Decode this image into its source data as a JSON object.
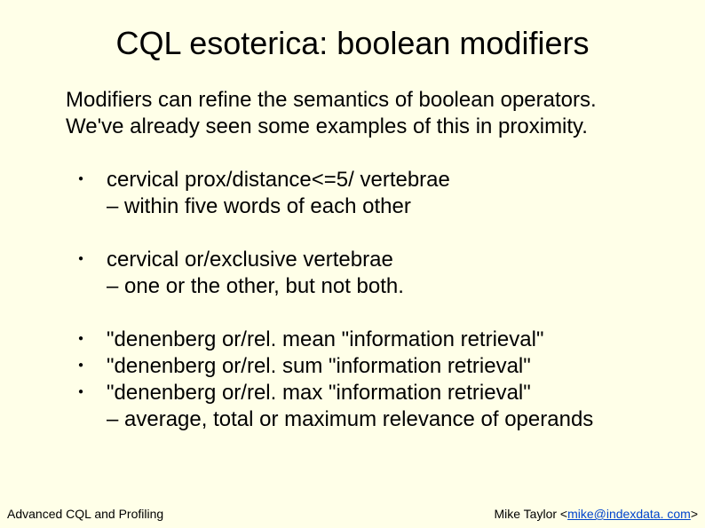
{
  "title": "CQL esoterica: boolean modifiers",
  "intro": "Modifiers can refine the semantics of boolean operators. We've already seen some examples of this in proximity.",
  "bullets": [
    {
      "main": "cervical prox/distance<=5/ vertebrae",
      "sub": "– within five words of each other",
      "tight": false
    },
    {
      "main": "cervical or/exclusive vertebrae",
      "sub": "– one or the other, but not both.",
      "tight": false
    },
    {
      "main": "\"denenberg or/rel. mean \"information retrieval\"",
      "sub": "",
      "tight": true
    },
    {
      "main": "\"denenberg or/rel. sum \"information retrieval\"",
      "sub": "",
      "tight": true
    },
    {
      "main": "\"denenberg or/rel. max \"information retrieval\"",
      "sub": "– average, total or maximum relevance of operands",
      "tight": false
    }
  ],
  "footer": {
    "left": "Advanced CQL and Profiling",
    "right_prefix": "Mike Taylor <",
    "right_link": "mike@indexdata. com",
    "right_suffix": ">"
  }
}
